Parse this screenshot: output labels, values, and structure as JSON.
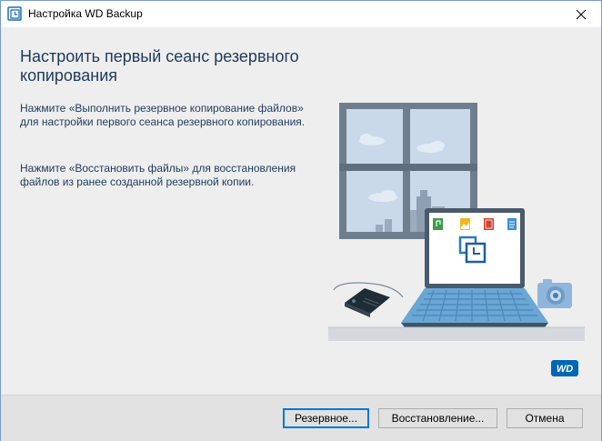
{
  "window": {
    "title": "Настройка WD Backup",
    "close_glyph": "✕"
  },
  "content": {
    "heading": "Настроить первый сеанс резервного копирования",
    "paragraph_backup": "Нажмите «Выполнить резервное копирование файлов» для настройки первого сеанса резервного копирования.",
    "paragraph_restore": "Нажмите «Восстановить файлы» для восстановления файлов из ранее созданной резервной копии.",
    "logo_text": "WD"
  },
  "buttons": {
    "backup_label": "Резервное...",
    "restore_label": "Восстановление...",
    "cancel_label": "Отмена"
  },
  "colors": {
    "text": "#1e3a5c",
    "accent": "#0078d7",
    "wd_blue": "#0066b3"
  },
  "icons": [
    "wd-backup-app-icon",
    "close-icon",
    "music-file-icon",
    "image-file-icon",
    "video-file-icon",
    "document-file-icon",
    "backup-clock-icon"
  ]
}
